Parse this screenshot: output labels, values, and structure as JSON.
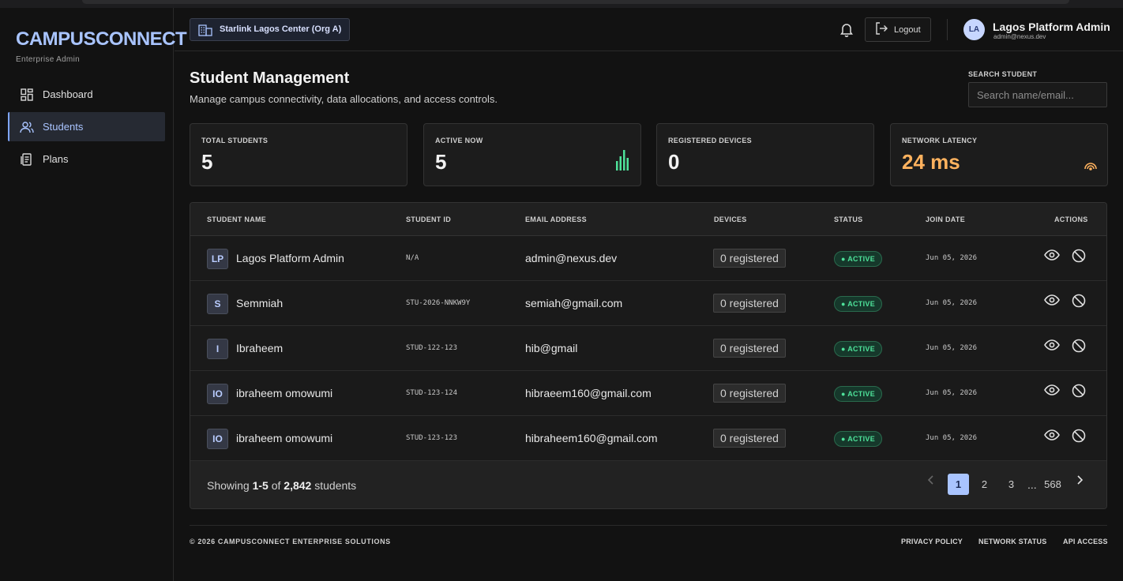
{
  "brand": {
    "name": "CAMPUSCONNECT",
    "subtitle": "Enterprise Admin"
  },
  "sidebar": {
    "items": [
      {
        "label": "Dashboard",
        "icon": "grid-icon",
        "active": false
      },
      {
        "label": "Students",
        "icon": "users-icon",
        "active": true
      },
      {
        "label": "Plans",
        "icon": "document-icon",
        "active": false
      }
    ]
  },
  "header": {
    "org": "Starlink Lagos Center (Org A)",
    "logout_label": "Logout",
    "user": {
      "initials": "LA",
      "name": "Lagos Platform Admin",
      "email": "admin@nexus.dev"
    }
  },
  "page": {
    "title": "Student Management",
    "subtitle": "Manage campus connectivity, data allocations, and access controls.",
    "search_label": "SEARCH STUDENT",
    "search_placeholder": "Search name/email...",
    "search_value": ""
  },
  "stats": [
    {
      "label": "TOTAL STUDENTS",
      "value": "5"
    },
    {
      "label": "ACTIVE NOW",
      "value": "5"
    },
    {
      "label": "REGISTERED DEVICES",
      "value": "0"
    },
    {
      "label": "NETWORK LATENCY",
      "value": "24 ms"
    }
  ],
  "table": {
    "columns": [
      "STUDENT NAME",
      "STUDENT ID",
      "EMAIL ADDRESS",
      "DEVICES",
      "STATUS",
      "JOIN DATE",
      "ACTIONS"
    ],
    "rows": [
      {
        "initials": "LP",
        "name": "Lagos Platform Admin",
        "id": "N/A",
        "email": "admin@nexus.dev",
        "devices": "0 registered",
        "status": "ACTIVE",
        "date": "Jun 05, 2026"
      },
      {
        "initials": "S",
        "name": "Semmiah",
        "id": "STU-2026-NNKW9Y",
        "email": "semiah@gmail.com",
        "devices": "0 registered",
        "status": "ACTIVE",
        "date": "Jun 05, 2026"
      },
      {
        "initials": "I",
        "name": "Ibraheem",
        "id": "STUD-122-123",
        "email": "hib@gmail",
        "devices": "0 registered",
        "status": "ACTIVE",
        "date": "Jun 05, 2026"
      },
      {
        "initials": "IO",
        "name": "ibraheem omowumi",
        "id": "STUD-123-124",
        "email": "hibraeem160@gmail.com",
        "devices": "0 registered",
        "status": "ACTIVE",
        "date": "Jun 05, 2026"
      },
      {
        "initials": "IO",
        "name": "ibraheem omowumi",
        "id": "STUD-123-123",
        "email": "hibraheem160@gmail.com",
        "devices": "0 registered",
        "status": "ACTIVE",
        "date": "Jun 05, 2026"
      }
    ],
    "footer": {
      "showing_prefix": "Showing ",
      "showing_range": "1-5",
      "showing_of": " of ",
      "showing_total": "2,842",
      "showing_suffix": " students"
    },
    "pagination": {
      "pages": [
        "1",
        "2",
        "3"
      ],
      "ellipsis": "...",
      "last": "568",
      "current": "1"
    }
  },
  "footer": {
    "copyright": "© 2026 CAMPUSCONNECT ENTERPRISE SOLUTIONS",
    "links": [
      "PRIVACY POLICY",
      "NETWORK STATUS",
      "API ACCESS"
    ]
  },
  "colors": {
    "accent": "#a9c4ff",
    "active_green": "#4ee29a",
    "latency_orange": "#ffb25e",
    "background": "#121212"
  }
}
